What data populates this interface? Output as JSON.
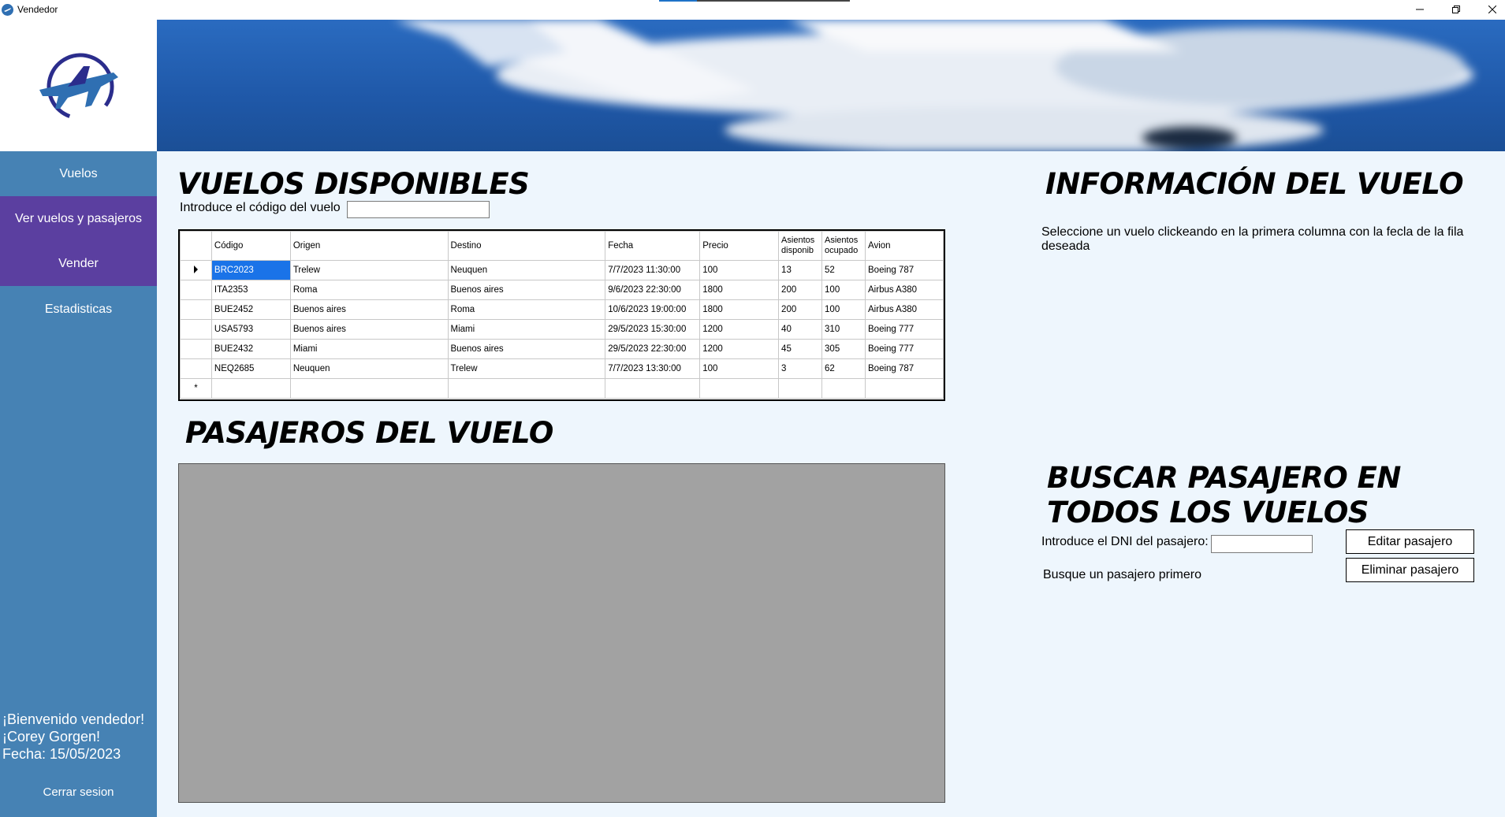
{
  "window": {
    "title": "Vendedor"
  },
  "sidebar": {
    "items": [
      {
        "label": "Vuelos"
      },
      {
        "label": "Ver vuelos y pasajeros"
      },
      {
        "label": "Vender"
      },
      {
        "label": "Estadisticas"
      }
    ],
    "welcome_line1": "¡Bienvenido vendedor!",
    "welcome_line2": "¡Corey Gorgen!",
    "welcome_line3": "Fecha: 15/05/2023",
    "logout_label": "Cerrar sesion"
  },
  "flights": {
    "title": "VUELOS DISPONIBLES",
    "code_label": "Introduce el código del vuelo",
    "code_value": "",
    "columns": [
      "Código",
      "Origen",
      "Destino",
      "Fecha",
      "Precio",
      "Asientos disponib",
      "Asientos ocupado",
      "Avion"
    ],
    "rows": [
      [
        "BRC2023",
        "Trelew",
        "Neuquen",
        "7/7/2023 11:30:00",
        "100",
        "13",
        "52",
        "Boeing 787"
      ],
      [
        "ITA2353",
        "Roma",
        "Buenos aires",
        "9/6/2023 22:30:00",
        "1800",
        "200",
        "100",
        "Airbus A380"
      ],
      [
        "BUE2452",
        "Buenos aires",
        "Roma",
        "10/6/2023 19:00:00",
        "1800",
        "200",
        "100",
        "Airbus A380"
      ],
      [
        "USA5793",
        "Buenos aires",
        "Miami",
        "29/5/2023 15:30:00",
        "1200",
        "40",
        "310",
        "Boeing 777"
      ],
      [
        "BUE2432",
        "Miami",
        "Buenos aires",
        "29/5/2023 22:30:00",
        "1200",
        "45",
        "305",
        "Boeing 777"
      ],
      [
        "NEQ2685",
        "Neuquen",
        "Trelew",
        "7/7/2023 13:30:00",
        "100",
        "3",
        "62",
        "Boeing 787"
      ]
    ],
    "new_row_marker": "*"
  },
  "passengers": {
    "title": "PASAJEROS DEL VUELO"
  },
  "info": {
    "title": "INFORMACIÓN DEL VUELO",
    "text": "Seleccione un vuelo clickeando en la primera columna con la fecla de la fila deseada"
  },
  "search": {
    "title": "BUSCAR PASAJERO EN TODOS LOS VUELOS",
    "dni_label": "Introduce el DNI del pasajero:",
    "dni_value": "",
    "edit_label": "Editar pasajero",
    "delete_label": "Eliminar pasajero",
    "hint": "Busque un pasajero primero"
  },
  "colors": {
    "sidebar": "#4682b4",
    "sidebar_active": "#5b3fa0",
    "content_bg": "#eef6fd",
    "selection": "#1a73e8"
  },
  "icons": [
    "airplane-logo-icon",
    "minimize-icon",
    "restore-icon",
    "close-icon",
    "row-pointer-icon"
  ]
}
